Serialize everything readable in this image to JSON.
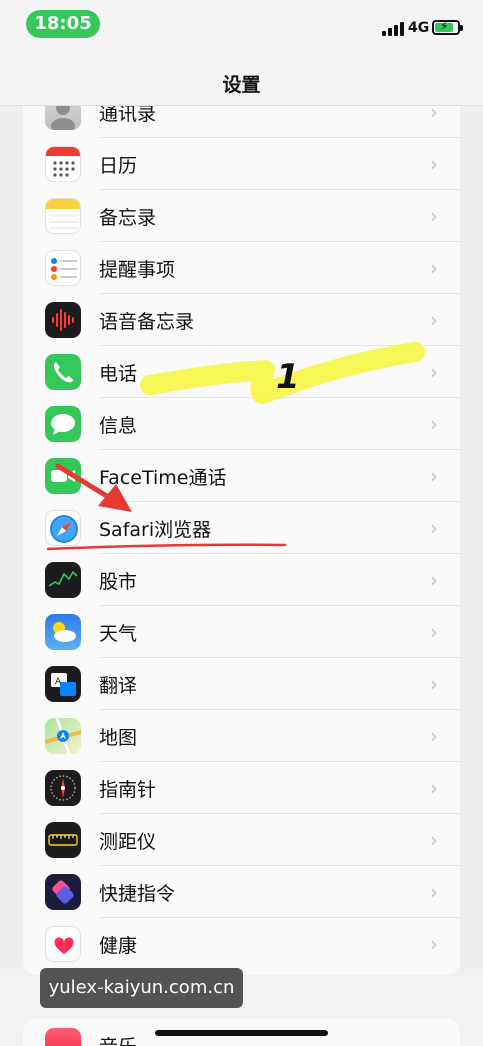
{
  "status_bar": {
    "time": "18:05",
    "network": "4G"
  },
  "nav": {
    "title": "设置"
  },
  "rows": [
    {
      "label": "通讯录",
      "icon": "contacts-icon"
    },
    {
      "label": "日历",
      "icon": "calendar-icon"
    },
    {
      "label": "备忘录",
      "icon": "notes-icon"
    },
    {
      "label": "提醒事项",
      "icon": "reminders-icon"
    },
    {
      "label": "语音备忘录",
      "icon": "voice-memos-icon"
    },
    {
      "label": "电话",
      "icon": "phone-icon"
    },
    {
      "label": "信息",
      "icon": "messages-icon"
    },
    {
      "label": "FaceTime通话",
      "icon": "facetime-icon"
    },
    {
      "label": "Safari浏览器",
      "icon": "safari-icon"
    },
    {
      "label": "股市",
      "icon": "stocks-icon"
    },
    {
      "label": "天气",
      "icon": "weather-icon"
    },
    {
      "label": "翻译",
      "icon": "translate-icon"
    },
    {
      "label": "地图",
      "icon": "maps-icon"
    },
    {
      "label": "指南针",
      "icon": "compass-icon"
    },
    {
      "label": "测距仪",
      "icon": "measure-icon"
    },
    {
      "label": "快捷指令",
      "icon": "shortcuts-icon"
    },
    {
      "label": "健康",
      "icon": "health-icon"
    }
  ],
  "next_section": {
    "label": "音乐",
    "icon": "music-icon"
  },
  "chevron": "›",
  "annotation": {
    "step_number": "1"
  },
  "watermark": "yulex-kaiyun.com.cn",
  "colors": {
    "accent_green": "#34c759",
    "highlighter_yellow": "#f7f53a",
    "annotation_red": "#e53935"
  }
}
